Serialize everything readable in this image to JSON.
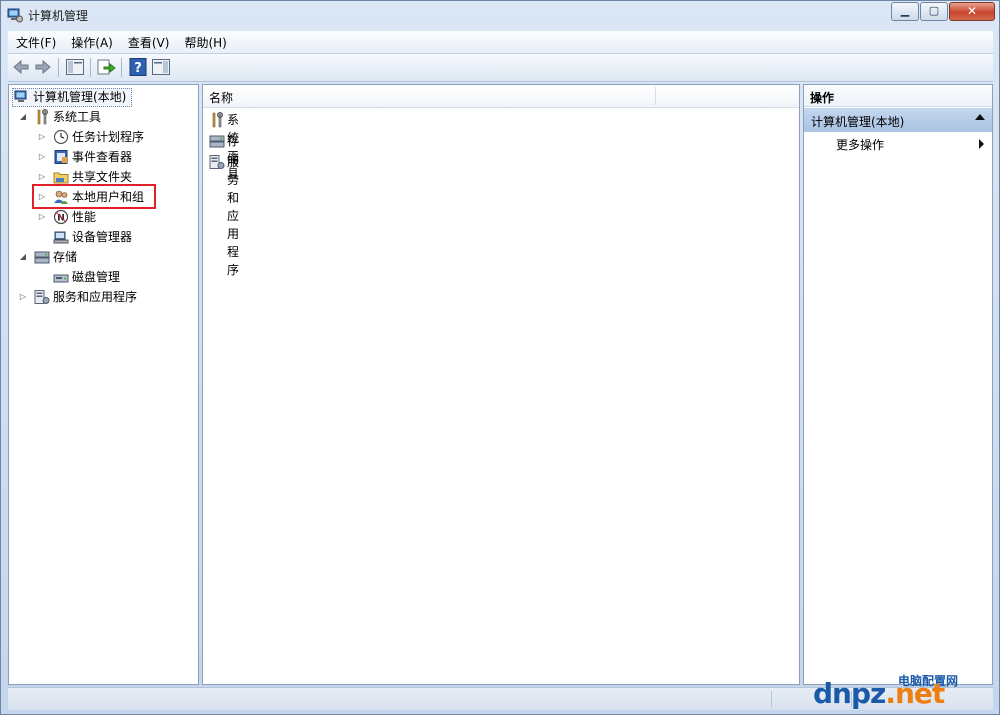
{
  "window": {
    "title": "计算机管理",
    "app_icon": "computer-management-icon",
    "controls": {
      "minimize": "minimize-icon",
      "maximize": "maximize-icon",
      "close": "close-icon"
    }
  },
  "menu": {
    "items": [
      "文件(F)",
      "操作(A)",
      "查看(V)",
      "帮助(H)"
    ]
  },
  "toolbar": {
    "buttons": [
      "back-icon",
      "forward-icon",
      "show-hide-tree-icon",
      "export-list-icon",
      "help-icon",
      "show-hide-action-pane-icon"
    ]
  },
  "tree": {
    "root": "计算机管理(本地)",
    "system_tools": "系统工具",
    "task_scheduler": "任务计划程序",
    "event_viewer": "事件查看器",
    "shared_folders": "共享文件夹",
    "local_users": "本地用户和组",
    "performance": "性能",
    "device_manager": "设备管理器",
    "storage": "存储",
    "disk_management": "磁盘管理",
    "services_apps": "服务和应用程序"
  },
  "center": {
    "column_name": "名称",
    "items": [
      "系统工具",
      "存储",
      "服务和应用程序"
    ]
  },
  "actions": {
    "header": "操作",
    "section": "计算机管理(本地)",
    "more": "更多操作"
  },
  "watermark": {
    "logo_main": "dnpz",
    "logo_ext": ".net",
    "subtitle": "电脑配置网"
  },
  "colors": {
    "highlight_box": "#e0212c",
    "action_section": "#b6cde9"
  }
}
